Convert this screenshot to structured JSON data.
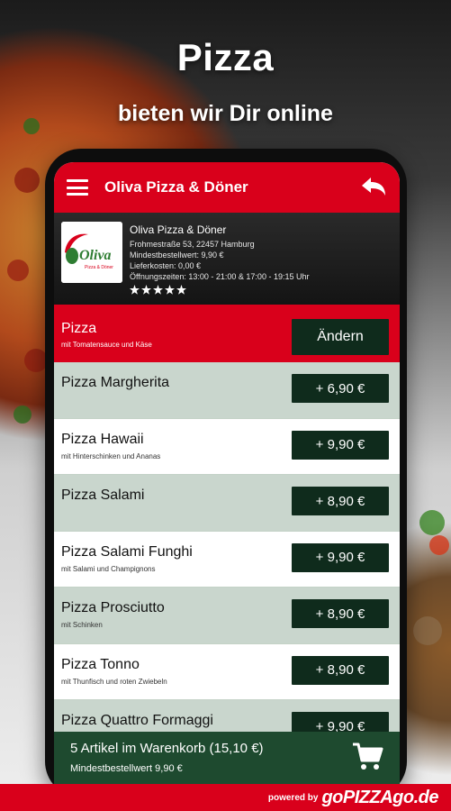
{
  "hero": {
    "title": "Pizza",
    "subtitle": "bieten wir Dir online"
  },
  "appbar": {
    "title": "Oliva Pizza & Döner",
    "menu_icon": "hamburger-icon",
    "back_icon": "back-arrow-icon"
  },
  "restaurant": {
    "name": "Oliva Pizza & Döner",
    "address": "Frohmestraße 53, 22457 Hamburg",
    "min_order": "Mindestbestellwert: 9,90 €",
    "delivery": "Lieferkosten: 0,00 €",
    "hours": "Öffnungszeiten: 13:00 - 21:00 & 17:00 - 19:15 Uhr",
    "logo_text": "Oliva",
    "logo_sub": "Pizza & Döner",
    "rating": 5
  },
  "category": {
    "name": "Pizza",
    "subtitle": "mit Tomatensauce und Käse",
    "change_label": "Ändern"
  },
  "items": [
    {
      "name": "Pizza Margherita",
      "desc": "",
      "price": "+ 6,90 €"
    },
    {
      "name": "Pizza Hawaii",
      "desc": "mit Hinterschinken und Ananas",
      "price": "+ 9,90 €"
    },
    {
      "name": "Pizza Salami",
      "desc": "",
      "price": "+ 8,90 €"
    },
    {
      "name": "Pizza Salami Funghi",
      "desc": "mit Salami und Champignons",
      "price": "+ 9,90 €"
    },
    {
      "name": "Pizza Prosciutto",
      "desc": "mit Schinken",
      "price": "+ 8,90 €"
    },
    {
      "name": "Pizza Tonno",
      "desc": "mit Thunfisch und roten Zwiebeln",
      "price": "+ 8,90 €"
    },
    {
      "name": "Pizza Quattro Formaggi",
      "desc": "",
      "price": "+ 9,90 €"
    }
  ],
  "cart": {
    "summary": "5 Artikel im Warenkorb (15,10 €)",
    "min_order": "Mindestbestellwert 9,90 €",
    "icon": "cart-icon"
  },
  "footer": {
    "powered": "powered by",
    "brand": "goPIZZAgo.de"
  },
  "colors": {
    "red": "#d9001b",
    "dark_green": "#0f2b1c",
    "row_alt": "#c9d6cd",
    "cart_green": "#1e4a2f"
  }
}
